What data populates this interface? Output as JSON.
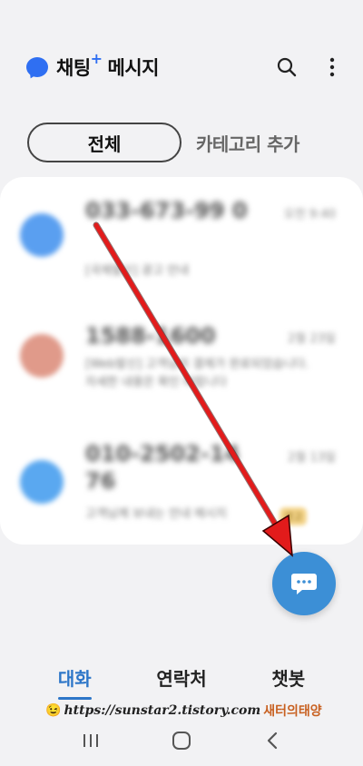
{
  "header": {
    "title": "채팅",
    "title_plus": "+",
    "title_rest": "메시지",
    "search_icon": "search-icon",
    "more_icon": "more-vert-icon"
  },
  "categories": {
    "all_label": "전체",
    "add_label": "카테고리 추가"
  },
  "conversations": [
    {
      "name": "033-673-99 0",
      "time": "오전 9:40",
      "preview": "[국제발신] 광고 안내",
      "avatar_color": "#5a9ff0"
    },
    {
      "name": "1588-1600",
      "time": "2월 23일",
      "preview": "[Web발신] 고객님의 결제가 완료되었습니다. 자세한 내용은 확인 바랍니다",
      "avatar_color": "#e09a8a"
    },
    {
      "name": "010-2502-14 76",
      "time": "2월 13일",
      "preview": "고객님께 보내는 안내 메시지",
      "avatar_color": "#5aa8f0",
      "tag": "광고"
    }
  ],
  "fab": {
    "icon": "chat-bubble-icon",
    "color": "#3c8fd6"
  },
  "bottom_tabs": [
    {
      "label": "대화",
      "active": true
    },
    {
      "label": "연락처",
      "active": false
    },
    {
      "label": "챗봇",
      "active": false
    }
  ],
  "watermark": {
    "emoji": "😉",
    "url": "https://sunstar2.tistory.com",
    "owner": "새터의태양"
  },
  "colors": {
    "accent": "#2d76c8",
    "annotation_arrow": "#e21b1b"
  }
}
